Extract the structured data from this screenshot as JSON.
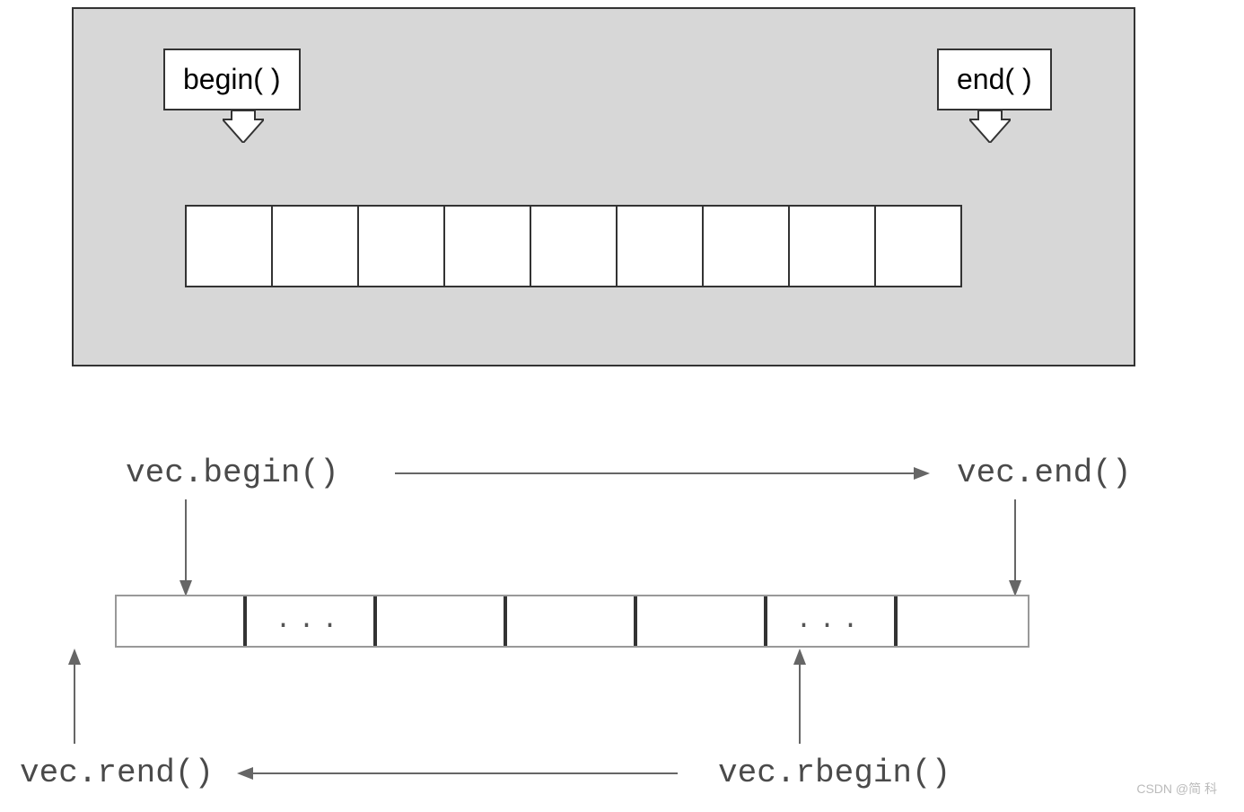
{
  "diagram1": {
    "begin_label": "begin( )",
    "end_label": "end( )",
    "cell_count": 9
  },
  "diagram2": {
    "vec_begin": "vec.begin()",
    "vec_end": "vec.end()",
    "vec_rend": "vec.rend()",
    "vec_rbegin": "vec.rbegin()",
    "cells": [
      "",
      "...",
      "",
      "",
      "",
      "...",
      ""
    ]
  },
  "watermark": "CSDN @简 科"
}
